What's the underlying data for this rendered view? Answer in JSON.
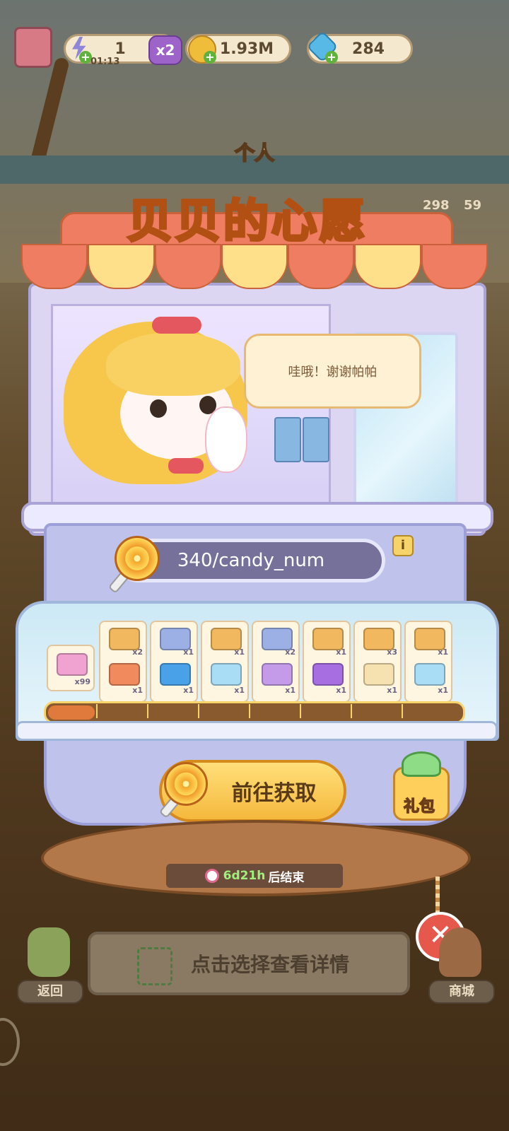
{
  "hud": {
    "energy_value": "1",
    "energy_multiplier": "x2",
    "energy_timer": "01:13",
    "coins": "1.93M",
    "gems": "284",
    "side_counter_1": "298",
    "side_counter_2": "59"
  },
  "header": {
    "subtitle": "个人",
    "title": "贝贝的心愿"
  },
  "speech_bubble": "哇哦！谢谢帕帕",
  "progress": {
    "text": "340/candy_num"
  },
  "rewards": [
    {
      "top_qty": "",
      "bottom_qty": "x99",
      "top_icon": "",
      "bottom_icon": "pink-ticket-icon",
      "top_color": "",
      "bottom_color": "#f0a3d0"
    },
    {
      "top_qty": "x2",
      "bottom_qty": "x1",
      "top_icon": "picnic-basket-icon",
      "bottom_icon": "clown-doll-icon",
      "top_color": "#f2b860",
      "bottom_color": "#f18a5c"
    },
    {
      "top_qty": "x1",
      "bottom_qty": "x1",
      "top_icon": "blue-basket-icon",
      "bottom_icon": "blue-mystery-box-icon",
      "top_color": "#9cb0e6",
      "bottom_color": "#49a2e8"
    },
    {
      "top_qty": "x1",
      "bottom_qty": "x1",
      "top_icon": "picnic-basket-icon",
      "bottom_icon": "energy-bottle-icon",
      "top_color": "#f2b860",
      "bottom_color": "#a9dcf5"
    },
    {
      "top_qty": "x2",
      "bottom_qty": "x1",
      "top_icon": "blue-basket-icon",
      "bottom_icon": "purple-chest-icon",
      "top_color": "#9cb0e6",
      "bottom_color": "#c39be8"
    },
    {
      "top_qty": "x1",
      "bottom_qty": "x1",
      "top_icon": "picnic-basket-icon",
      "bottom_icon": "purple-mystery-box-icon",
      "top_color": "#f2b860",
      "bottom_color": "#a66ee0"
    },
    {
      "top_qty": "x3",
      "bottom_qty": "x1",
      "top_icon": "picnic-basket-icon",
      "bottom_icon": "cream-chest-icon",
      "top_color": "#f2b860",
      "bottom_color": "#f6e2b0"
    },
    {
      "top_qty": "x1",
      "bottom_qty": "x1",
      "top_icon": "picnic-basket-icon",
      "bottom_icon": "energy-bottle-icon",
      "top_color": "#f2b860",
      "bottom_color": "#a9dcf5"
    }
  ],
  "goto_button": "前往获取",
  "gift_label": "礼包",
  "timer": {
    "value": "6d21h",
    "suffix": "后结束"
  },
  "bottom": {
    "detail_hint": "点击选择查看详情",
    "back_label": "返回",
    "shop_label": "商城"
  },
  "colors": {
    "title_fill": "#ffd34d",
    "title_stroke": "#b24f12",
    "awning_red": "#ef7d62",
    "awning_yellow": "#ffe08a"
  }
}
